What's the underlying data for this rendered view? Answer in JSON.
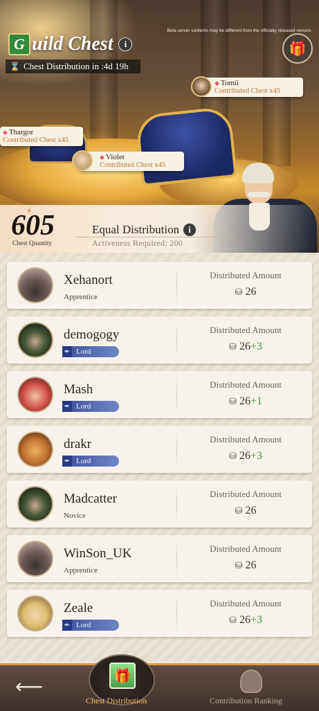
{
  "header": {
    "badge_letter": "G",
    "title": "uild Chest",
    "info_glyph": "i",
    "timer": "Chest Distribution in :4d 19h",
    "beta_notice": "Beta server contents may be different from the officially released version.",
    "gift_icon": "gift-icon"
  },
  "contributors": [
    {
      "name": "Tomii",
      "amount": "Contributed Chest x45"
    },
    {
      "name": "Thargor",
      "amount": "Contributed Chest x45"
    },
    {
      "name": "Violet",
      "amount": "Contributed Chest x45"
    }
  ],
  "summary": {
    "quantity": "605",
    "quantity_label": "Chest Quantity",
    "mode_title": "Equal Distribution",
    "requirement": "Activeness Required: 200"
  },
  "members": [
    {
      "name": "Xehanort",
      "rank": "Apprentice",
      "label": "Distributed Amount",
      "amount": "26",
      "bonus": ""
    },
    {
      "name": "demogogy",
      "rank": "Lord",
      "label": "Distributed Amount",
      "amount": "26",
      "bonus": "+3"
    },
    {
      "name": "Mash",
      "rank": "Lord",
      "label": "Distributed Amount",
      "amount": "26",
      "bonus": "+1"
    },
    {
      "name": "drakr",
      "rank": "Lord",
      "label": "Distributed Amount",
      "amount": "26",
      "bonus": "+3"
    },
    {
      "name": "Madcatter",
      "rank": "Novice",
      "label": "Distributed Amount",
      "amount": "26",
      "bonus": ""
    },
    {
      "name": "WinSon_UK",
      "rank": "Apprentice",
      "label": "Distributed Amount",
      "amount": "26",
      "bonus": ""
    },
    {
      "name": "Zeale",
      "rank": "Lord",
      "label": "Distributed Amount",
      "amount": "26",
      "bonus": "+3"
    }
  ],
  "nav": {
    "back_icon": "back-arrow-icon",
    "tab_distribution": "Chest Distribution",
    "tab_ranking": "Contribution Ranking"
  },
  "colors": {
    "accent": "#d8a040",
    "bonus": "#3a9a3a",
    "lord_badge": "#3e4f9a"
  }
}
